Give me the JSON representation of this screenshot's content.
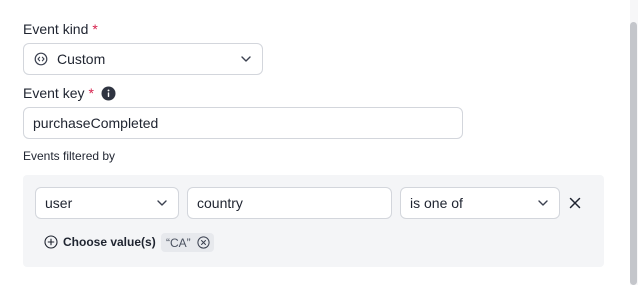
{
  "event_kind": {
    "label": "Event kind",
    "required_mark": "*",
    "selected_value": "Custom",
    "icon": "code-circle-icon"
  },
  "event_key": {
    "label": "Event key",
    "required_mark": "*",
    "value": "purchaseCompleted",
    "info_icon": "info-icon"
  },
  "filters": {
    "section_label": "Events filtered by",
    "rows": [
      {
        "context_kind": "user",
        "attribute": "country",
        "operator": "is one of",
        "choose_values_label": "Choose value(s)",
        "values": [
          "“CA”"
        ]
      }
    ]
  },
  "colors": {
    "required": "#d6204b",
    "panel_background": "#f4f5f7",
    "border": "#d3d6dc"
  }
}
